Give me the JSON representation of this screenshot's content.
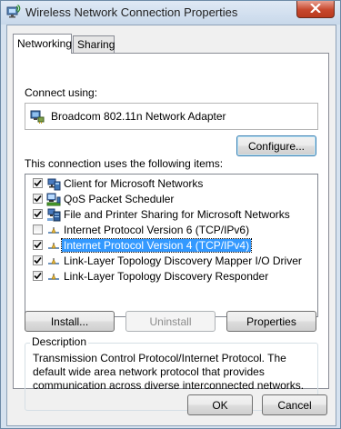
{
  "window": {
    "title": "Wireless Network Connection Properties",
    "close_icon": "close-x-icon",
    "title_icon": "wireless-network-icon"
  },
  "tabs": [
    {
      "label": "Networking",
      "active": true
    },
    {
      "label": "Sharing",
      "active": false
    }
  ],
  "connect_using": {
    "label": "Connect using:",
    "adapter_name": "Broadcom 802.11n Network Adapter",
    "adapter_icon": "network-adapter-icon",
    "configure_label": "Configure..."
  },
  "items_section": {
    "label": "This connection uses the following items:",
    "items": [
      {
        "label": "Client for Microsoft Networks",
        "checked": true,
        "selected": false,
        "icon": "network-client-icon"
      },
      {
        "label": "QoS Packet Scheduler",
        "checked": true,
        "selected": false,
        "icon": "qos-scheduler-icon"
      },
      {
        "label": "File and Printer Sharing for Microsoft Networks",
        "checked": true,
        "selected": false,
        "icon": "file-printer-sharing-icon"
      },
      {
        "label": "Internet Protocol Version 6 (TCP/IPv6)",
        "checked": false,
        "selected": false,
        "icon": "protocol-icon"
      },
      {
        "label": "Internet Protocol Version 4 (TCP/IPv4)",
        "checked": true,
        "selected": true,
        "icon": "protocol-icon"
      },
      {
        "label": "Link-Layer Topology Discovery Mapper I/O Driver",
        "checked": true,
        "selected": false,
        "icon": "protocol-icon"
      },
      {
        "label": "Link-Layer Topology Discovery Responder",
        "checked": true,
        "selected": false,
        "icon": "protocol-icon"
      }
    ]
  },
  "buttons": {
    "install": "Install...",
    "uninstall": "Uninstall",
    "properties": "Properties",
    "ok": "OK",
    "cancel": "Cancel"
  },
  "description": {
    "title": "Description",
    "text": "Transmission Control Protocol/Internet Protocol. The default wide area network protocol that provides communication across diverse interconnected networks."
  },
  "colors": {
    "selection": "#3399ff",
    "close_button": "#c7472c"
  }
}
